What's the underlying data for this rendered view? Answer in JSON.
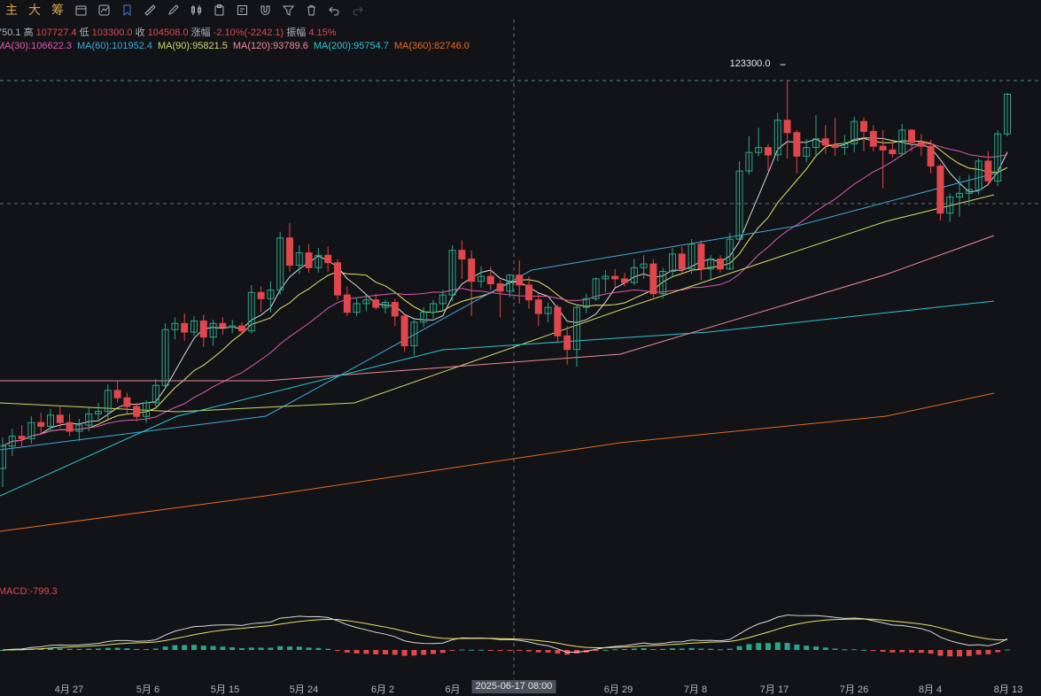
{
  "toolbar": {
    "text_items": [
      "主",
      "大",
      "筹"
    ],
    "icon_items": [
      "layers-icon",
      "indicator-settings-icon",
      "bookmark-icon",
      "ruler-icon",
      "pencil-icon",
      "candlestick-icon",
      "clipboard-icon",
      "note-icon",
      "magnet-icon",
      "filter-icon",
      "trash-icon",
      "undo-icon",
      "redo-icon"
    ]
  },
  "info": {
    "open_fragment": "750.1",
    "high_label": "高",
    "high_value": "107727.4",
    "low_label": "低",
    "low_value": "103300.0",
    "close_label": "收",
    "close_value": "104508.0",
    "change_label": "涨幅",
    "change_value": "-2.10%(-2242.1)",
    "amp_label": "振幅",
    "amp_value": "4.15%"
  },
  "ma_legend": [
    {
      "text": "MA(30):106622.3",
      "color": "#e05ab0"
    },
    {
      "text": "MA(60):101952.4",
      "color": "#3fa9e0"
    },
    {
      "text": "MA(90):95821.5",
      "color": "#cfd86a"
    },
    {
      "text": "MA(120):93789.6",
      "color": "#f08a9a"
    },
    {
      "text": "MA(200):95754.7",
      "color": "#2cc6d6"
    },
    {
      "text": "MA(360):82746.0",
      "color": "#e86a1f"
    }
  ],
  "high_marker": "123300.0",
  "macd_label": "MACD:-799.3",
  "x_labels": [
    "4月 27",
    "5月 6",
    "5月 15",
    "5月 24",
    "6月 2",
    "6月",
    "6月 29",
    "7月 8",
    "7月 17",
    "7月 26",
    "8月 4",
    "8月 13"
  ],
  "crosshair_date": "2025-06-17 08:00",
  "colors": {
    "up": "#2ca58a",
    "down": "#e0474c",
    "bg": "#121316"
  },
  "chart_data": {
    "type": "candlestick",
    "title": "",
    "high_marker_value": 123300.0,
    "ohlc": [
      [
        92000,
        94500,
        90500,
        93800
      ],
      [
        93800,
        95200,
        93000,
        94600
      ],
      [
        94600,
        95500,
        93700,
        94400
      ],
      [
        94400,
        96200,
        94000,
        95700
      ],
      [
        95700,
        96500,
        94800,
        95400
      ],
      [
        95400,
        96800,
        95000,
        96300
      ],
      [
        96300,
        97100,
        95300,
        95700
      ],
      [
        95700,
        96400,
        94600,
        95000
      ],
      [
        95000,
        96000,
        94200,
        95500
      ],
      [
        95500,
        96900,
        95000,
        96400
      ],
      [
        96400,
        97300,
        95800,
        96600
      ],
      [
        96600,
        98800,
        96000,
        98300
      ],
      [
        98300,
        99100,
        97300,
        97700
      ],
      [
        97700,
        98100,
        96400,
        97000
      ],
      [
        97000,
        97300,
        95800,
        96200
      ],
      [
        96200,
        97500,
        95700,
        97300
      ],
      [
        97300,
        99200,
        97000,
        98700
      ],
      [
        98700,
        103700,
        98400,
        103200
      ],
      [
        103200,
        104200,
        102400,
        103700
      ],
      [
        103700,
        104500,
        102300,
        103000
      ],
      [
        103000,
        104300,
        102700,
        103900
      ],
      [
        103900,
        104400,
        101800,
        102600
      ],
      [
        102600,
        104000,
        101900,
        103700
      ],
      [
        103700,
        104200,
        102800,
        103400
      ],
      [
        103400,
        104000,
        102900,
        103500
      ],
      [
        103500,
        103800,
        102800,
        103100
      ],
      [
        103100,
        106800,
        102900,
        106200
      ],
      [
        106200,
        106700,
        104600,
        105700
      ],
      [
        105700,
        107100,
        104600,
        106400
      ],
      [
        106400,
        111100,
        106000,
        110600
      ],
      [
        110600,
        111800,
        107900,
        108400
      ],
      [
        108400,
        110000,
        107700,
        109400
      ],
      [
        109400,
        110100,
        107800,
        108200
      ],
      [
        108200,
        109800,
        107800,
        109200
      ],
      [
        109200,
        109900,
        107900,
        108600
      ],
      [
        108600,
        108900,
        105600,
        106000
      ],
      [
        106000,
        106700,
        104300,
        104600
      ],
      [
        104600,
        105800,
        104300,
        105300
      ],
      [
        105300,
        106000,
        104700,
        105600
      ],
      [
        105600,
        106100,
        104800,
        105000
      ],
      [
        105000,
        105600,
        104500,
        105400
      ],
      [
        105400,
        105700,
        103500,
        104300
      ],
      [
        104300,
        104500,
        101400,
        101900
      ],
      [
        101900,
        104000,
        101100,
        103800
      ],
      [
        103800,
        105000,
        103400,
        104600
      ],
      [
        104600,
        105600,
        104100,
        105300
      ],
      [
        105300,
        106400,
        104700,
        106000
      ],
      [
        106000,
        110000,
        105500,
        109600
      ],
      [
        109600,
        110400,
        107300,
        108900
      ],
      [
        108900,
        109600,
        104300,
        107100
      ],
      [
        107100,
        108300,
        106600,
        107500
      ],
      [
        107500,
        108300,
        106400,
        106900
      ],
      [
        106900,
        107200,
        104200,
        106300
      ],
      [
        106300,
        107700,
        105800,
        107600
      ],
      [
        107600,
        108800,
        105300,
        106800
      ],
      [
        106800,
        107500,
        104900,
        105600
      ],
      [
        105600,
        106100,
        103500,
        104500
      ],
      [
        104500,
        105400,
        103800,
        105000
      ],
      [
        105000,
        105200,
        102200,
        102700
      ],
      [
        102700,
        103500,
        100400,
        101600
      ],
      [
        101600,
        105200,
        100200,
        105000
      ],
      [
        105000,
        106100,
        104500,
        105700
      ],
      [
        105700,
        107400,
        105500,
        107300
      ],
      [
        107300,
        108000,
        106200,
        107500
      ],
      [
        107500,
        108100,
        106600,
        107300
      ],
      [
        107300,
        107800,
        106700,
        107000
      ],
      [
        107000,
        108900,
        106800,
        108200
      ],
      [
        108200,
        109200,
        107300,
        108500
      ],
      [
        108500,
        108900,
        105800,
        106100
      ],
      [
        106100,
        108200,
        105700,
        107900
      ],
      [
        107900,
        109800,
        107500,
        109300
      ],
      [
        109300,
        109900,
        107700,
        108100
      ],
      [
        108100,
        110500,
        107700,
        110100
      ],
      [
        110100,
        110400,
        107200,
        108100
      ],
      [
        108100,
        109200,
        107300,
        108900
      ],
      [
        108900,
        109200,
        107800,
        108100
      ],
      [
        108100,
        111000,
        108000,
        110500
      ],
      [
        110500,
        116800,
        110200,
        116000
      ],
      [
        116000,
        118800,
        115700,
        117500
      ],
      [
        117500,
        119500,
        117200,
        117900
      ],
      [
        117900,
        118200,
        116000,
        117300
      ],
      [
        117300,
        120700,
        116800,
        120100
      ],
      [
        120100,
        123300,
        117000,
        119100
      ],
      [
        119100,
        119300,
        115800,
        117200
      ],
      [
        117200,
        118600,
        116700,
        117900
      ],
      [
        117900,
        120500,
        117100,
        118600
      ],
      [
        118600,
        119700,
        117400,
        118100
      ],
      [
        118100,
        120300,
        117200,
        117900
      ],
      [
        117900,
        118900,
        117300,
        118200
      ],
      [
        118200,
        120400,
        117500,
        120000
      ],
      [
        120000,
        120300,
        117600,
        119200
      ],
      [
        119200,
        119700,
        117600,
        118000
      ],
      [
        118000,
        119300,
        114600,
        117700
      ],
      [
        117700,
        118400,
        117100,
        117400
      ],
      [
        117400,
        119800,
        117200,
        119300
      ],
      [
        119300,
        119400,
        117600,
        118300
      ],
      [
        118300,
        119000,
        117200,
        118000
      ],
      [
        118000,
        118500,
        115800,
        116400
      ],
      [
        116400,
        116600,
        112000,
        112600
      ],
      [
        112600,
        114200,
        111900,
        113900
      ],
      [
        113900,
        115600,
        112300,
        114200
      ],
      [
        114200,
        115700,
        113200,
        114500
      ],
      [
        114500,
        117000,
        114100,
        116800
      ],
      [
        116800,
        117600,
        114800,
        115200
      ],
      [
        115200,
        119300,
        114800,
        119000
      ],
      [
        119000,
        122300,
        118800,
        122200
      ]
    ]
  }
}
